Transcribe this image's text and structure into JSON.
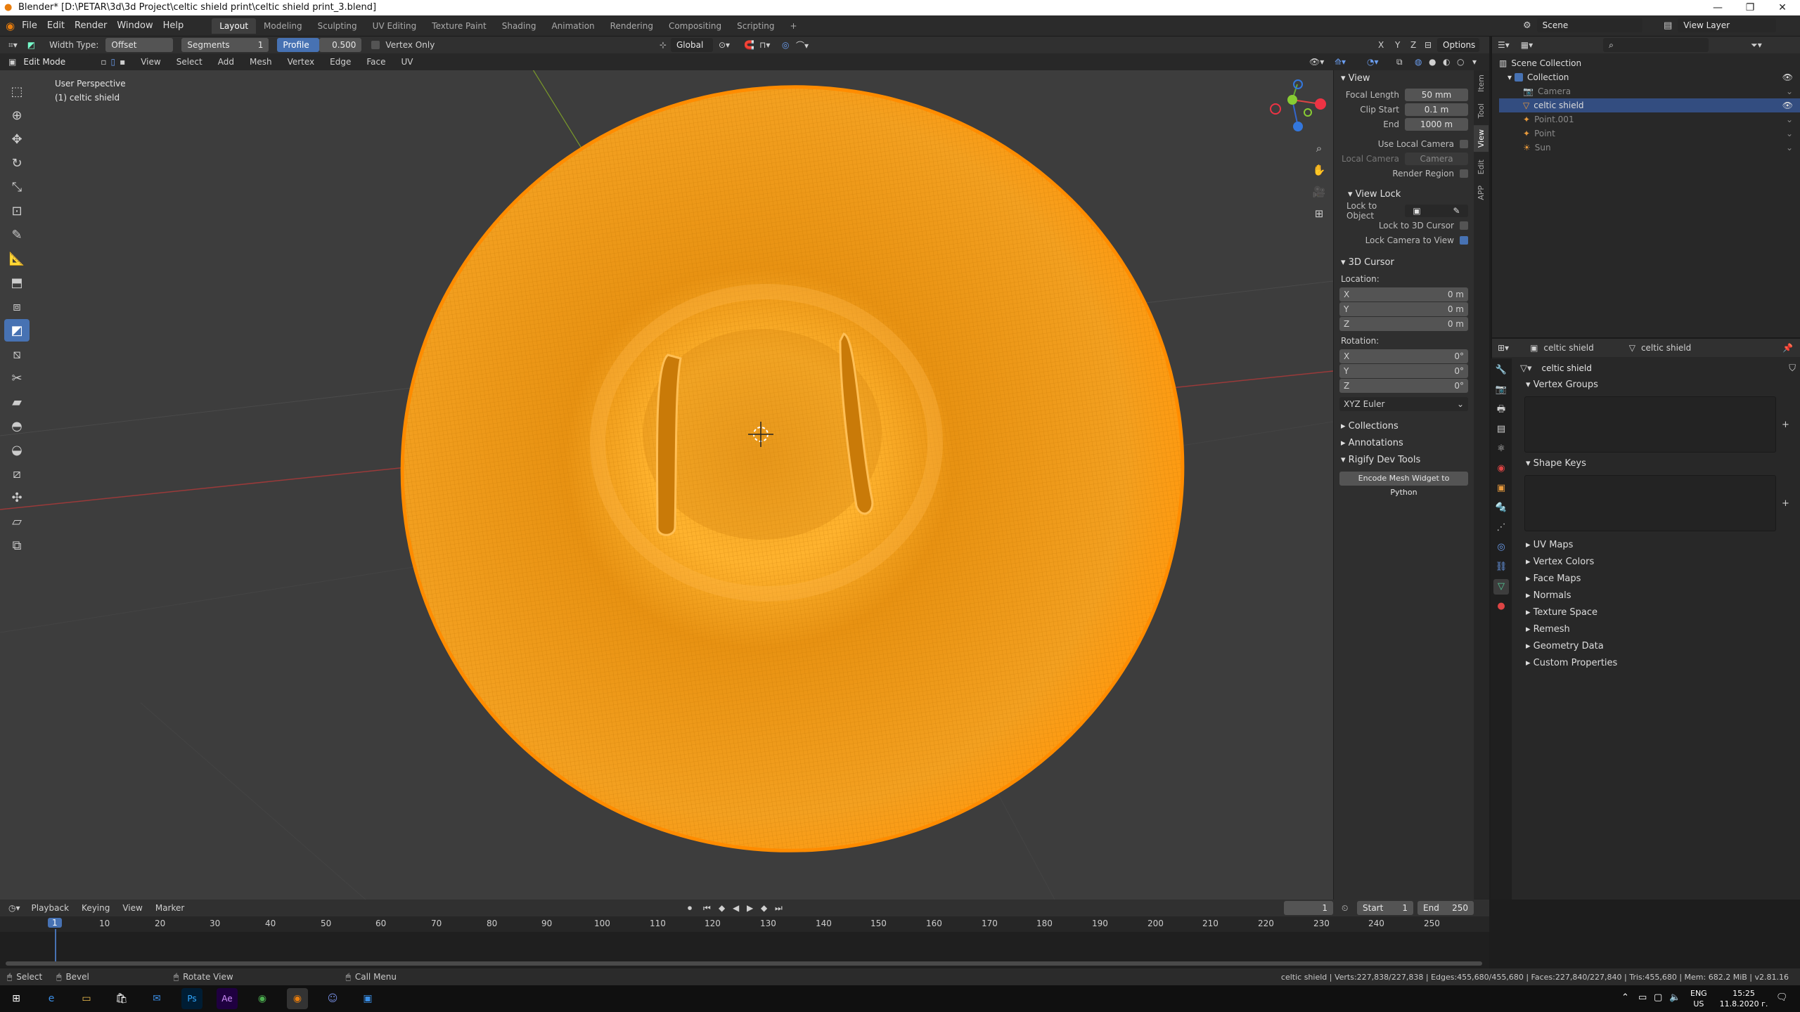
{
  "window": {
    "title": "Blender* [D:\\PETAR\\3d\\3d Project\\celtic shield print\\celtic shield print_3.blend]"
  },
  "menu": {
    "items": [
      "File",
      "Edit",
      "Render",
      "Window",
      "Help"
    ]
  },
  "workspaces": [
    "Layout",
    "Modeling",
    "Sculpting",
    "UV Editing",
    "Texture Paint",
    "Shading",
    "Animation",
    "Rendering",
    "Compositing",
    "Scripting",
    "+"
  ],
  "scene": {
    "label": "Scene",
    "view_layer": "View Layer"
  },
  "tool_settings": {
    "width_type_label": "Width Type:",
    "width_type_value": "Offset",
    "segments_label": "Segments",
    "segments_value": "1",
    "profile_label": "Profile",
    "profile_value": "0.500",
    "vertex_only_label": "Vertex Only",
    "vertex_only": false,
    "transform_orientation": "Global",
    "options_label": "Options"
  },
  "view_header": {
    "mode": "Edit Mode",
    "menus": [
      "View",
      "Select",
      "Add",
      "Mesh",
      "Vertex",
      "Edge",
      "Face",
      "UV"
    ]
  },
  "viewport": {
    "perspective_label": "User Perspective",
    "object_label": "(1) celtic shield",
    "mesh_color": "#ff9a1a",
    "background": "#3d3d3d"
  },
  "npanel": {
    "tabs": [
      "Item",
      "Tool",
      "View",
      "Edit",
      "APP"
    ],
    "active_tab": "View",
    "view_section": "View",
    "focal_length_label": "Focal Length",
    "focal_length": "50 mm",
    "clip_start_label": "Clip Start",
    "clip_start": "0.1 m",
    "end_label": "End",
    "end": "1000 m",
    "use_local_camera_label": "Use Local Camera",
    "use_local_camera": false,
    "local_camera_label": "Local Camera",
    "local_camera_value": "Camera",
    "render_region_label": "Render Region",
    "render_region": false,
    "view_lock_section": "View Lock",
    "lock_to_object_label": "Lock to Object",
    "lock_to_3d_cursor_label": "Lock to 3D Cursor",
    "lock_to_3d_cursor": false,
    "lock_camera_to_view_label": "Lock Camera to View",
    "lock_camera_to_view": true,
    "cursor_section": "3D Cursor",
    "location_label": "Location:",
    "loc_x": "0 m",
    "loc_y": "0 m",
    "loc_z": "0 m",
    "rotation_label": "Rotation:",
    "rot_x": "0°",
    "rot_y": "0°",
    "rot_z": "0°",
    "rotation_mode": "XYZ Euler",
    "collections_section": "Collections",
    "annotations_section": "Annotations",
    "rigify_section": "Rigify Dev Tools",
    "encode_button": "Encode Mesh Widget to Python",
    "axis_x": "X",
    "axis_y": "Y",
    "axis_z": "Z"
  },
  "outliner": {
    "root": "Scene Collection",
    "collection": "Collection",
    "items": [
      {
        "name": "Camera",
        "selected": false
      },
      {
        "name": "celtic shield",
        "selected": true
      },
      {
        "name": "Point.001",
        "selected": false
      },
      {
        "name": "Point",
        "selected": false
      },
      {
        "name": "Sun",
        "selected": false
      }
    ]
  },
  "properties": {
    "object_name": "celtic shield",
    "data_name": "celtic shield",
    "mesh_name": "celtic shield",
    "vertex_groups": "Vertex Groups",
    "shape_keys": "Shape Keys",
    "sections": [
      "UV Maps",
      "Vertex Colors",
      "Face Maps",
      "Normals",
      "Texture Space",
      "Remesh",
      "Geometry Data",
      "Custom Properties"
    ]
  },
  "timeline": {
    "menus": [
      "Playback",
      "Keying",
      "View",
      "Marker"
    ],
    "current_frame": "1",
    "start_label": "Start",
    "start": "1",
    "end_label": "End",
    "end": "250",
    "ruler_ticks": [
      "10",
      "20",
      "30",
      "40",
      "50",
      "60",
      "70",
      "80",
      "90",
      "100",
      "110",
      "120",
      "130",
      "140",
      "150",
      "160",
      "170",
      "180",
      "190",
      "200",
      "210",
      "220",
      "230",
      "240",
      "250"
    ]
  },
  "statusbar": {
    "select": "Select",
    "bevel": "Bevel",
    "rotate_view": "Rotate View",
    "call_menu": "Call Menu",
    "stats": "celtic shield | Verts:227,838/227,838 | Edges:455,680/455,680 | Faces:227,840/227,840 | Tris:455,680 | Mem: 682.2 MiB | v2.81.16"
  },
  "taskbar": {
    "lang": "ENG",
    "lang2": "US",
    "time": "15:25",
    "date": "11.8.2020 г."
  }
}
